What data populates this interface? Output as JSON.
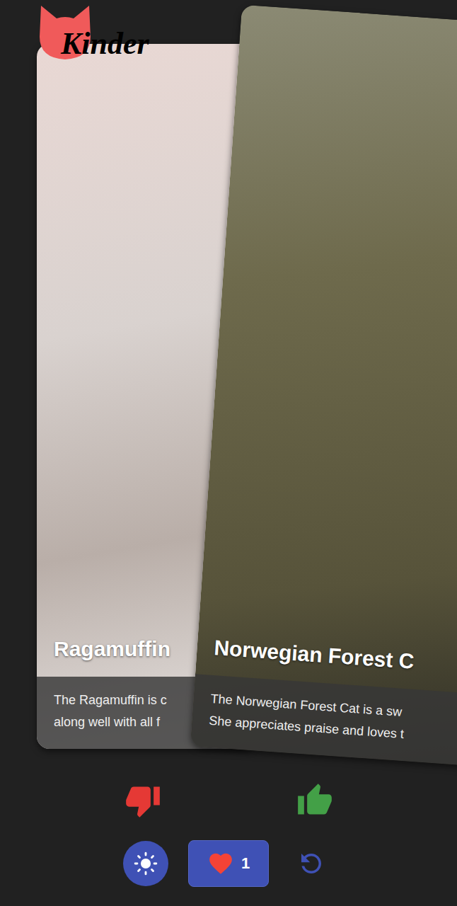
{
  "app": {
    "logo": "Kinder"
  },
  "cards": [
    {
      "title": "Ragamuffin",
      "description": [
        "The Ragamuffin is c",
        "along well with all f"
      ],
      "photo": "#d9d2cf"
    },
    {
      "title": "Norwegian Forest C",
      "description": [
        "The Norwegian Forest Cat is a sw",
        "She appreciates praise and loves t"
      ],
      "photo": "#6e6a4c"
    }
  ],
  "actions": [
    {
      "name": "dislike",
      "color": "#e53935"
    },
    {
      "name": "like",
      "color": "#43a047"
    }
  ],
  "favorites": {
    "count": "1"
  }
}
